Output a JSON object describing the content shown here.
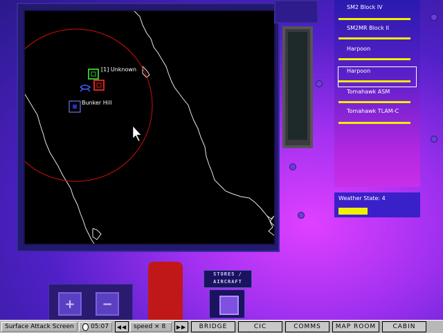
{
  "map": {
    "contacts": [
      {
        "label": "[1] Unknown"
      },
      {
        "label": "Bunker Hill"
      }
    ]
  },
  "weapons": {
    "items": [
      {
        "label": "SM2 Block IV"
      },
      {
        "label": "SM2MR Block II"
      },
      {
        "label": "Harpoon"
      },
      {
        "label": "Harpoon",
        "selected": true
      },
      {
        "label": "Tomahawk ASM"
      },
      {
        "label": "Tomahawk TLAM-C"
      }
    ]
  },
  "weather": {
    "label": "Weather State: 4",
    "level": 4
  },
  "pads": {
    "plus": "+",
    "minus": "−"
  },
  "stores": {
    "line1": "STORES /",
    "line2": "AIRCRAFT"
  },
  "statusbar": {
    "screen": "Surface Attack Screen",
    "time": "05:07",
    "rewind": "◀◀",
    "speed": "speed × 8",
    "forward": "▶▶",
    "buttons": [
      "BRIDGE",
      "CIC",
      "COMMS",
      "MAP ROOM",
      "CABIN"
    ]
  },
  "colors": {
    "accent_yellow": "#f0f000",
    "range_ring": "#d01010",
    "friendly": "#4060ff",
    "unknown": "#30c030",
    "hostile": "#e02020"
  }
}
